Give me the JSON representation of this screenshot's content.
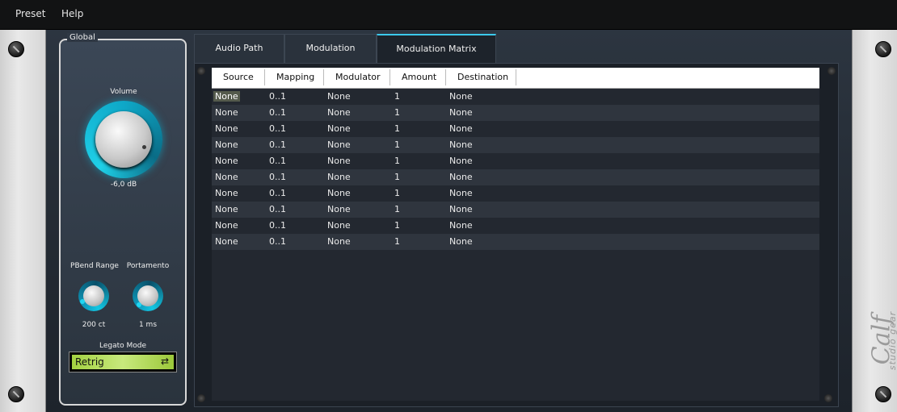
{
  "menu": {
    "preset": "Preset",
    "help": "Help"
  },
  "global": {
    "title": "Global",
    "volume": {
      "label": "Volume",
      "value": "-6,0 dB"
    },
    "pbend": {
      "label": "PBend Range",
      "value": "200 ct"
    },
    "portamento": {
      "label": "Portamento",
      "value": "1 ms"
    },
    "legato": {
      "label": "Legato Mode",
      "value": "Retrig"
    }
  },
  "tabs": [
    {
      "label": "Audio Path"
    },
    {
      "label": "Modulation"
    },
    {
      "label": "Modulation Matrix"
    }
  ],
  "active_tab": "Modulation Matrix",
  "matrix": {
    "columns": [
      "Source",
      "Mapping",
      "Modulator",
      "Amount",
      "Destination"
    ],
    "rows": [
      [
        "None",
        "0..1",
        "None",
        "1",
        "None"
      ],
      [
        "None",
        "0..1",
        "None",
        "1",
        "None"
      ],
      [
        "None",
        "0..1",
        "None",
        "1",
        "None"
      ],
      [
        "None",
        "0..1",
        "None",
        "1",
        "None"
      ],
      [
        "None",
        "0..1",
        "None",
        "1",
        "None"
      ],
      [
        "None",
        "0..1",
        "None",
        "1",
        "None"
      ],
      [
        "None",
        "0..1",
        "None",
        "1",
        "None"
      ],
      [
        "None",
        "0..1",
        "None",
        "1",
        "None"
      ],
      [
        "None",
        "0..1",
        "None",
        "1",
        "None"
      ],
      [
        "None",
        "0..1",
        "None",
        "1",
        "None"
      ]
    ]
  },
  "brand": {
    "logo": "Calf",
    "sub": "studio gear"
  },
  "colors": {
    "accent": "#3cc9ec",
    "lcd": "#b4dc5a"
  }
}
